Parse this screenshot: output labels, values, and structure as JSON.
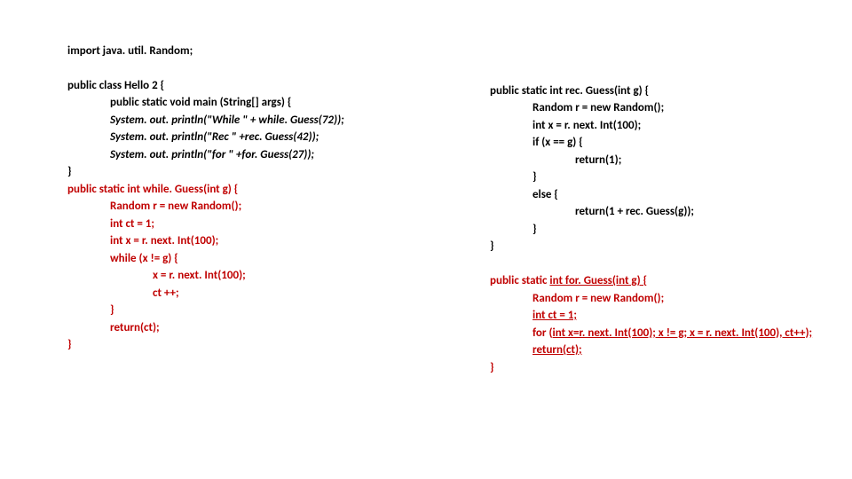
{
  "left": {
    "l01": "import java. util. Random;",
    "l02": "public class Hello 2 {",
    "l03": "public static void main (String[] args) {",
    "l04": "System. out. println(\"While \" + while. Guess(72));",
    "l05": "System. out. println(\"Rec \" +rec. Guess(42));",
    "l06": "System. out. println(\"for \" +for. Guess(27));",
    "l07": "}",
    "l08": "public static int while. Guess(int g) {",
    "l09": "Random r = new Random();",
    "l10": "int ct = 1;",
    "l11": "int x = r. next. Int(100);",
    "l12": "while (x != g) {",
    "l13": "x = r. next. Int(100);",
    "l14": "ct ++;",
    "l15": "}",
    "l16": "return(ct);",
    "l17": "}"
  },
  "right": {
    "r01": "public static int rec. Guess(int g) {",
    "r02": "Random r = new Random();",
    "r03": "int x = r. next. Int(100);",
    "r04": "if (x == g) {",
    "r05": "return(1);",
    "r06": "}",
    "r07": "else {",
    "r08": "return(1 + rec. Guess(g));",
    "r09": "}",
    "r10": "}",
    "r11": "public static ",
    "r12": "int for. Guess(int g) {",
    "r13": "Random r = new Random();",
    "r14": "int ct = 1;",
    "r15": "for (",
    "r16": "int x=r. next. Int(100); x != g; x = r. next. Int(100), ct++);",
    "r17": "return(ct);",
    "r18": "}"
  }
}
